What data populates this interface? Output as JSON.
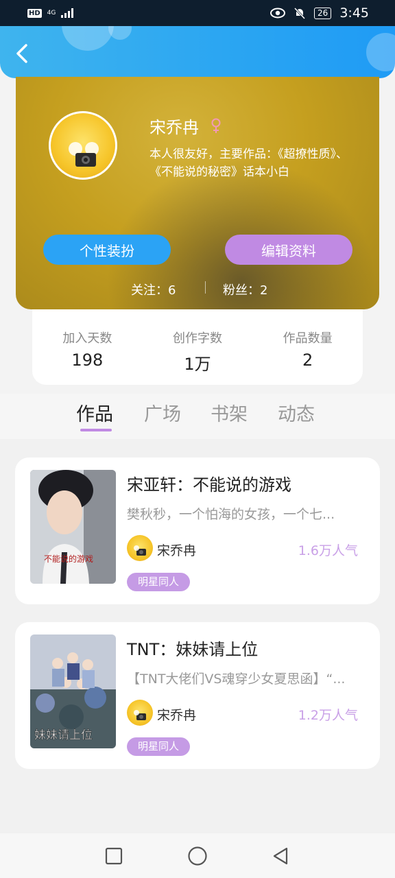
{
  "status_bar": {
    "network_badge": "HD",
    "network_type": "4G",
    "battery": "26",
    "time": "3:45"
  },
  "header": {
    "back_icon": "chevron-left-icon"
  },
  "profile": {
    "name": "宋乔冉",
    "gender_icon": "female-icon",
    "bio": "本人很友好，主要作品：《超撩性质》、《不能说的秘密》话本小白",
    "dress_button": "个性装扮",
    "edit_button": "编辑资料",
    "following": "关注：6",
    "followers": "粉丝：2"
  },
  "stats": [
    {
      "label": "加入天数",
      "value": "198"
    },
    {
      "label": "创作字数",
      "value": "1万"
    },
    {
      "label": "作品数量",
      "value": "2"
    }
  ],
  "tabs": [
    {
      "label": "作品",
      "active": true
    },
    {
      "label": "广场",
      "active": false
    },
    {
      "label": "书架",
      "active": false
    },
    {
      "label": "动态",
      "active": false
    }
  ],
  "works": [
    {
      "title": "宋亚轩：不能说的游戏",
      "description": "樊秋秒，一个怕海的女孩，一个七...",
      "author": "宋乔冉",
      "popularity": "1.6万人气",
      "tag": "明星同人",
      "cover_text": "不能说的游戏"
    },
    {
      "title": "TNT：妹妹请上位",
      "description": "【TNT大佬们VS魂穿少女夏思函】“...",
      "author": "宋乔冉",
      "popularity": "1.2万人气",
      "tag": "明星同人",
      "cover_text": "妹妹请上位"
    }
  ],
  "navbar": {
    "recent_icon": "square-icon",
    "home_icon": "circle-icon",
    "back_icon": "triangle-back-icon"
  },
  "colors": {
    "accent_blue": "#2ba3f5",
    "accent_purple": "#c08ae3",
    "profile_gold": "#c59f1f"
  }
}
